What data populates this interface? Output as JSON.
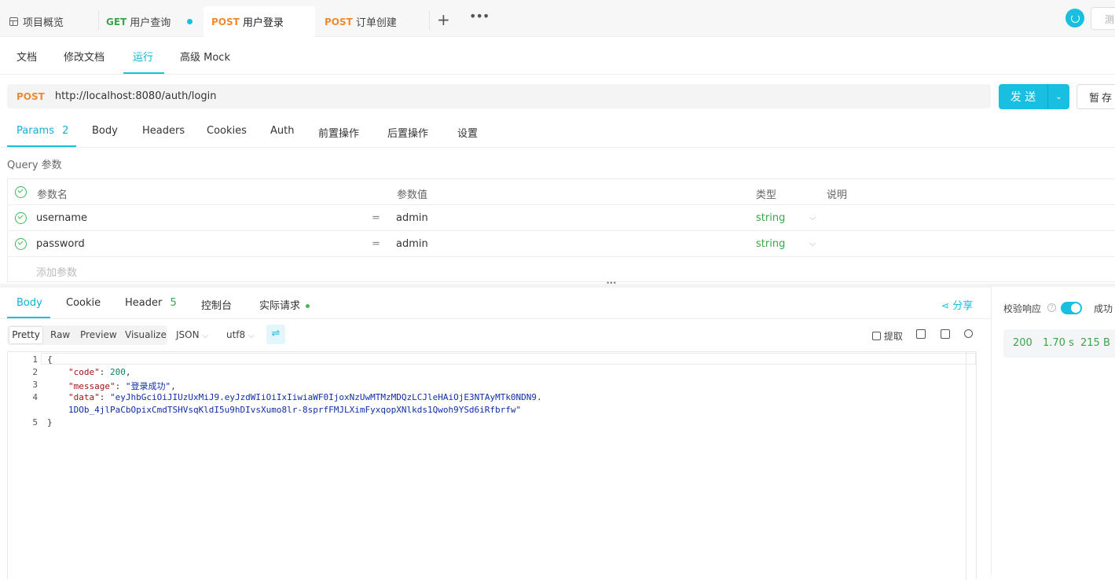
{
  "file_tabs": [
    {
      "label": "项目概览",
      "method": ""
    },
    {
      "label": "用户查询",
      "method": "GET"
    },
    {
      "label": "用户登录",
      "method": "POST"
    },
    {
      "label": "订单创建",
      "method": "POST"
    }
  ],
  "top_right": {
    "partial_label": "测"
  },
  "subnav": [
    "文档",
    "修改文档",
    "运行",
    "高级 Mock"
  ],
  "request": {
    "method": "POST",
    "url": "http://localhost:8080/auth/login",
    "send_label": "发 送",
    "save_label": "暂存"
  },
  "request_tabs": {
    "params": "Params",
    "params_count": "2",
    "items": [
      "Body",
      "Headers",
      "Cookies",
      "Auth",
      "前置操作",
      "后置操作",
      "设置"
    ]
  },
  "query_label": "Query 参数",
  "params_table": {
    "headers": [
      "参数名",
      "参数值",
      "类型",
      "说明"
    ],
    "rows": [
      {
        "name": "username",
        "eq": "=",
        "value": "admin",
        "type": "string"
      },
      {
        "name": "password",
        "eq": "=",
        "value": "admin",
        "type": "string"
      }
    ],
    "add_placeholder": "添加参数"
  },
  "response_tabs": {
    "body": "Body",
    "cookie": "Cookie",
    "header": "Header",
    "header_count": "5",
    "console": "控制台",
    "actual": "实际请求",
    "share": "分享"
  },
  "format_bar": {
    "modes": [
      "Pretty",
      "Raw",
      "Preview",
      "Visualize"
    ],
    "lang": "JSON",
    "encoding": "utf8",
    "extract": "提取"
  },
  "code_lines": {
    "l1": "{",
    "l2_key": "\"code\"",
    "l2_val": "200",
    "l3_key": "\"message\"",
    "l3_val": "\"登录成功\"",
    "l4_key": "\"data\"",
    "l4_val_a": "\"eyJhbGciOiJIUzUxMiJ9.eyJzdWIiOiIxIiwiaWF0IjoxNzUwMTMzMDQzLCJleHAiOjE3NTAyMTk0NDN9.",
    "l4_val_b": "1DOb_4jlPaCbOpixCmdTSHVsqKldI5u9hDIvsXumo8lr-8sprfFMJLXimFyxqopXNlkds1Qwoh9YSd6iRfbrfw\"",
    "l5": "}",
    "numbers": [
      "1",
      "2",
      "3",
      "4",
      "5"
    ]
  },
  "side": {
    "validate_label": "校验响应",
    "success_label": "成功",
    "status": "200",
    "time": "1.70 s",
    "size": "215 B"
  }
}
